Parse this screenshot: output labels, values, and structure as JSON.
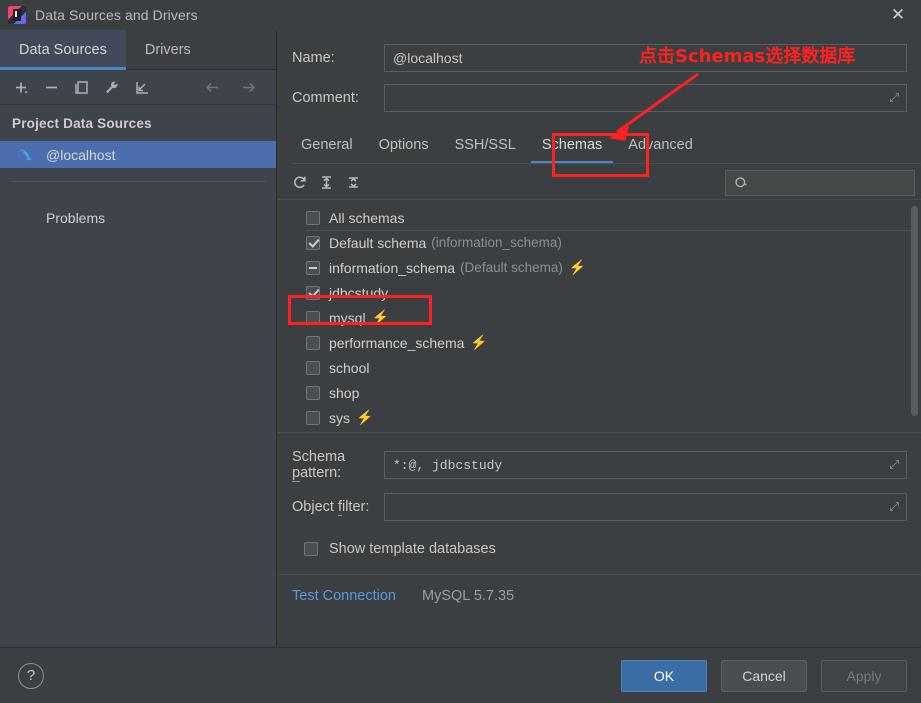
{
  "window": {
    "title": "Data Sources and Drivers",
    "app_icon": "intellij-idea-icon",
    "close_label": "✕"
  },
  "left_panel": {
    "tabs": [
      {
        "label": "Data Sources",
        "active": true
      },
      {
        "label": "Drivers",
        "active": false
      }
    ],
    "toolbar": [
      {
        "name": "add-icon",
        "glyph": "+"
      },
      {
        "name": "remove-icon",
        "glyph": "−"
      },
      {
        "name": "copy-icon",
        "glyph": "copy"
      },
      {
        "name": "wrench-icon",
        "glyph": "wrench"
      },
      {
        "name": "import-icon",
        "glyph": "import"
      },
      {
        "name": "back-arrow-icon",
        "glyph": "←"
      },
      {
        "name": "forward-arrow-icon",
        "glyph": "→"
      }
    ],
    "section_title": "Project Data Sources",
    "data_sources": [
      {
        "label": "@localhost",
        "icon": "mysql-dolphin-icon",
        "selected": true
      }
    ],
    "problems_label": "Problems"
  },
  "main": {
    "name_label": "Name:",
    "name_value": "@localhost",
    "comment_label": "Comment:",
    "comment_value": "",
    "tabs": [
      {
        "label": "General",
        "active": false
      },
      {
        "label": "Options",
        "active": false
      },
      {
        "label": "SSH/SSL",
        "active": false
      },
      {
        "label": "Schemas",
        "active": true
      },
      {
        "label": "Advanced",
        "active": false
      }
    ],
    "schema_toolbar": [
      {
        "name": "refresh-icon"
      },
      {
        "name": "expand-all-icon"
      },
      {
        "name": "collapse-all-icon"
      }
    ],
    "search": {
      "placeholder": "",
      "value": "",
      "icon": "search-icon"
    },
    "schemas": [
      {
        "name": "All schemas",
        "state": "unchecked",
        "note": "",
        "bolt": false,
        "separator_after": true,
        "highlight": false
      },
      {
        "name": "Default schema",
        "state": "checked",
        "note": "(information_schema)",
        "bolt": false,
        "separator_after": false,
        "highlight": false
      },
      {
        "name": "information_schema",
        "state": "indeterminate",
        "note": "(Default schema)",
        "bolt": true,
        "separator_after": false,
        "highlight": false
      },
      {
        "name": "jdbcstudy",
        "state": "checked",
        "note": "",
        "bolt": false,
        "separator_after": false,
        "highlight": true
      },
      {
        "name": "mysql",
        "state": "unchecked",
        "note": "",
        "bolt": true,
        "separator_after": false,
        "highlight": false
      },
      {
        "name": "performance_schema",
        "state": "unchecked",
        "note": "",
        "bolt": true,
        "separator_after": false,
        "highlight": false
      },
      {
        "name": "school",
        "state": "unchecked",
        "note": "",
        "bolt": false,
        "separator_after": false,
        "highlight": false
      },
      {
        "name": "shop",
        "state": "unchecked",
        "note": "",
        "bolt": false,
        "separator_after": false,
        "highlight": false
      },
      {
        "name": "sys",
        "state": "unchecked",
        "note": "",
        "bolt": true,
        "separator_after": false,
        "highlight": false
      }
    ],
    "schema_pattern_label": "Schema pattern:",
    "schema_pattern_value": "*:@, jdbcstudy",
    "object_filter_label": "Object filter:",
    "object_filter_value": "",
    "show_template_label": "Show template databases",
    "show_template_checked": false,
    "test_connection_label": "Test Connection",
    "db_version": "MySQL 5.7.35"
  },
  "footer": {
    "help_label": "?",
    "ok_label": "OK",
    "cancel_label": "Cancel",
    "apply_label": "Apply"
  },
  "annotations": {
    "callout_text": "点击Schemas选择数据库",
    "color": "#ff2020"
  },
  "colors": {
    "accent_blue": "#4a88c7",
    "selection_blue": "#4b6eaf",
    "primary_button": "#3c6ea5",
    "link_blue": "#5a9ae0",
    "panel_bg": "#3c3f41",
    "sidebar_bg": "#3f434b",
    "bolt_orange": "#f0a732"
  }
}
